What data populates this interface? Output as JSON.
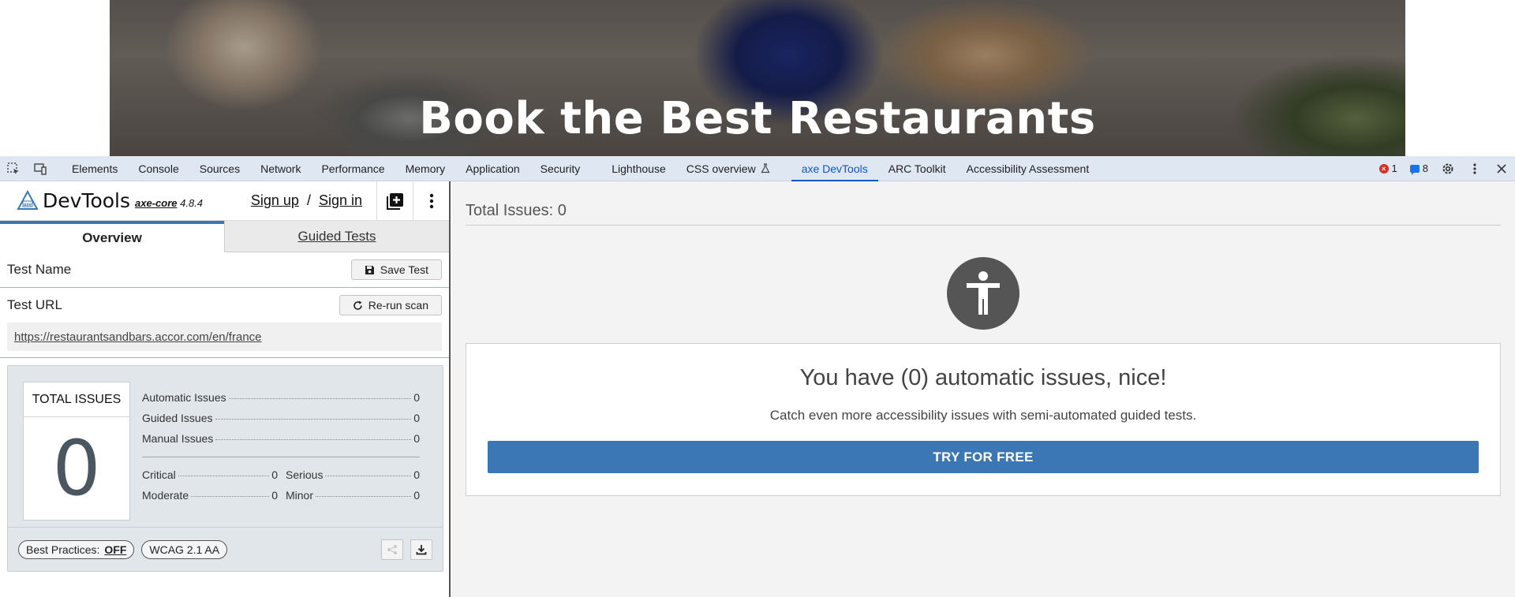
{
  "hero": {
    "title": "Book the Best Restaurants"
  },
  "devtools": {
    "tabs": [
      "Elements",
      "Console",
      "Sources",
      "Network",
      "Performance",
      "Memory",
      "Application",
      "Security",
      "Lighthouse",
      "CSS overview",
      "axe DevTools",
      "ARC Toolkit",
      "Accessibility Assessment"
    ],
    "active_tab": "axe DevTools",
    "error_count": "1",
    "message_count": "8",
    "accent_color": "#0b57d0"
  },
  "axe": {
    "brand": "DevTools",
    "core_name": "axe-core",
    "core_version": "4.8.4",
    "sign_up": "Sign up",
    "sign_sep": "/",
    "sign_in": "Sign in",
    "tabs": {
      "overview": "Overview",
      "guided": "Guided Tests"
    },
    "test_name_label": "Test Name",
    "save_test": "Save Test",
    "test_url_label": "Test URL",
    "rerun_scan": "Re-run scan",
    "test_url": "https://restaurantsandbars.accor.com/en/france",
    "total_issues_title": "TOTAL ISSUES",
    "total_issues": "0",
    "automatic_label": "Automatic Issues",
    "automatic": "0",
    "guided_label": "Guided Issues",
    "guided": "0",
    "manual_label": "Manual Issues",
    "manual": "0",
    "critical_label": "Critical",
    "critical": "0",
    "serious_label": "Serious",
    "serious": "0",
    "moderate_label": "Moderate",
    "moderate": "0",
    "minor_label": "Minor",
    "minor": "0",
    "best_practices_label": "Best Practices:",
    "best_practices_value": "OFF",
    "wcag": "WCAG 2.1 AA",
    "brand_color": "#3b77b5"
  },
  "results": {
    "total_label": "Total Issues: 0",
    "headline": "You have (0) automatic issues, nice!",
    "subtext": "Catch even more accessibility issues with semi-automated guided tests.",
    "cta": "TRY FOR FREE"
  }
}
